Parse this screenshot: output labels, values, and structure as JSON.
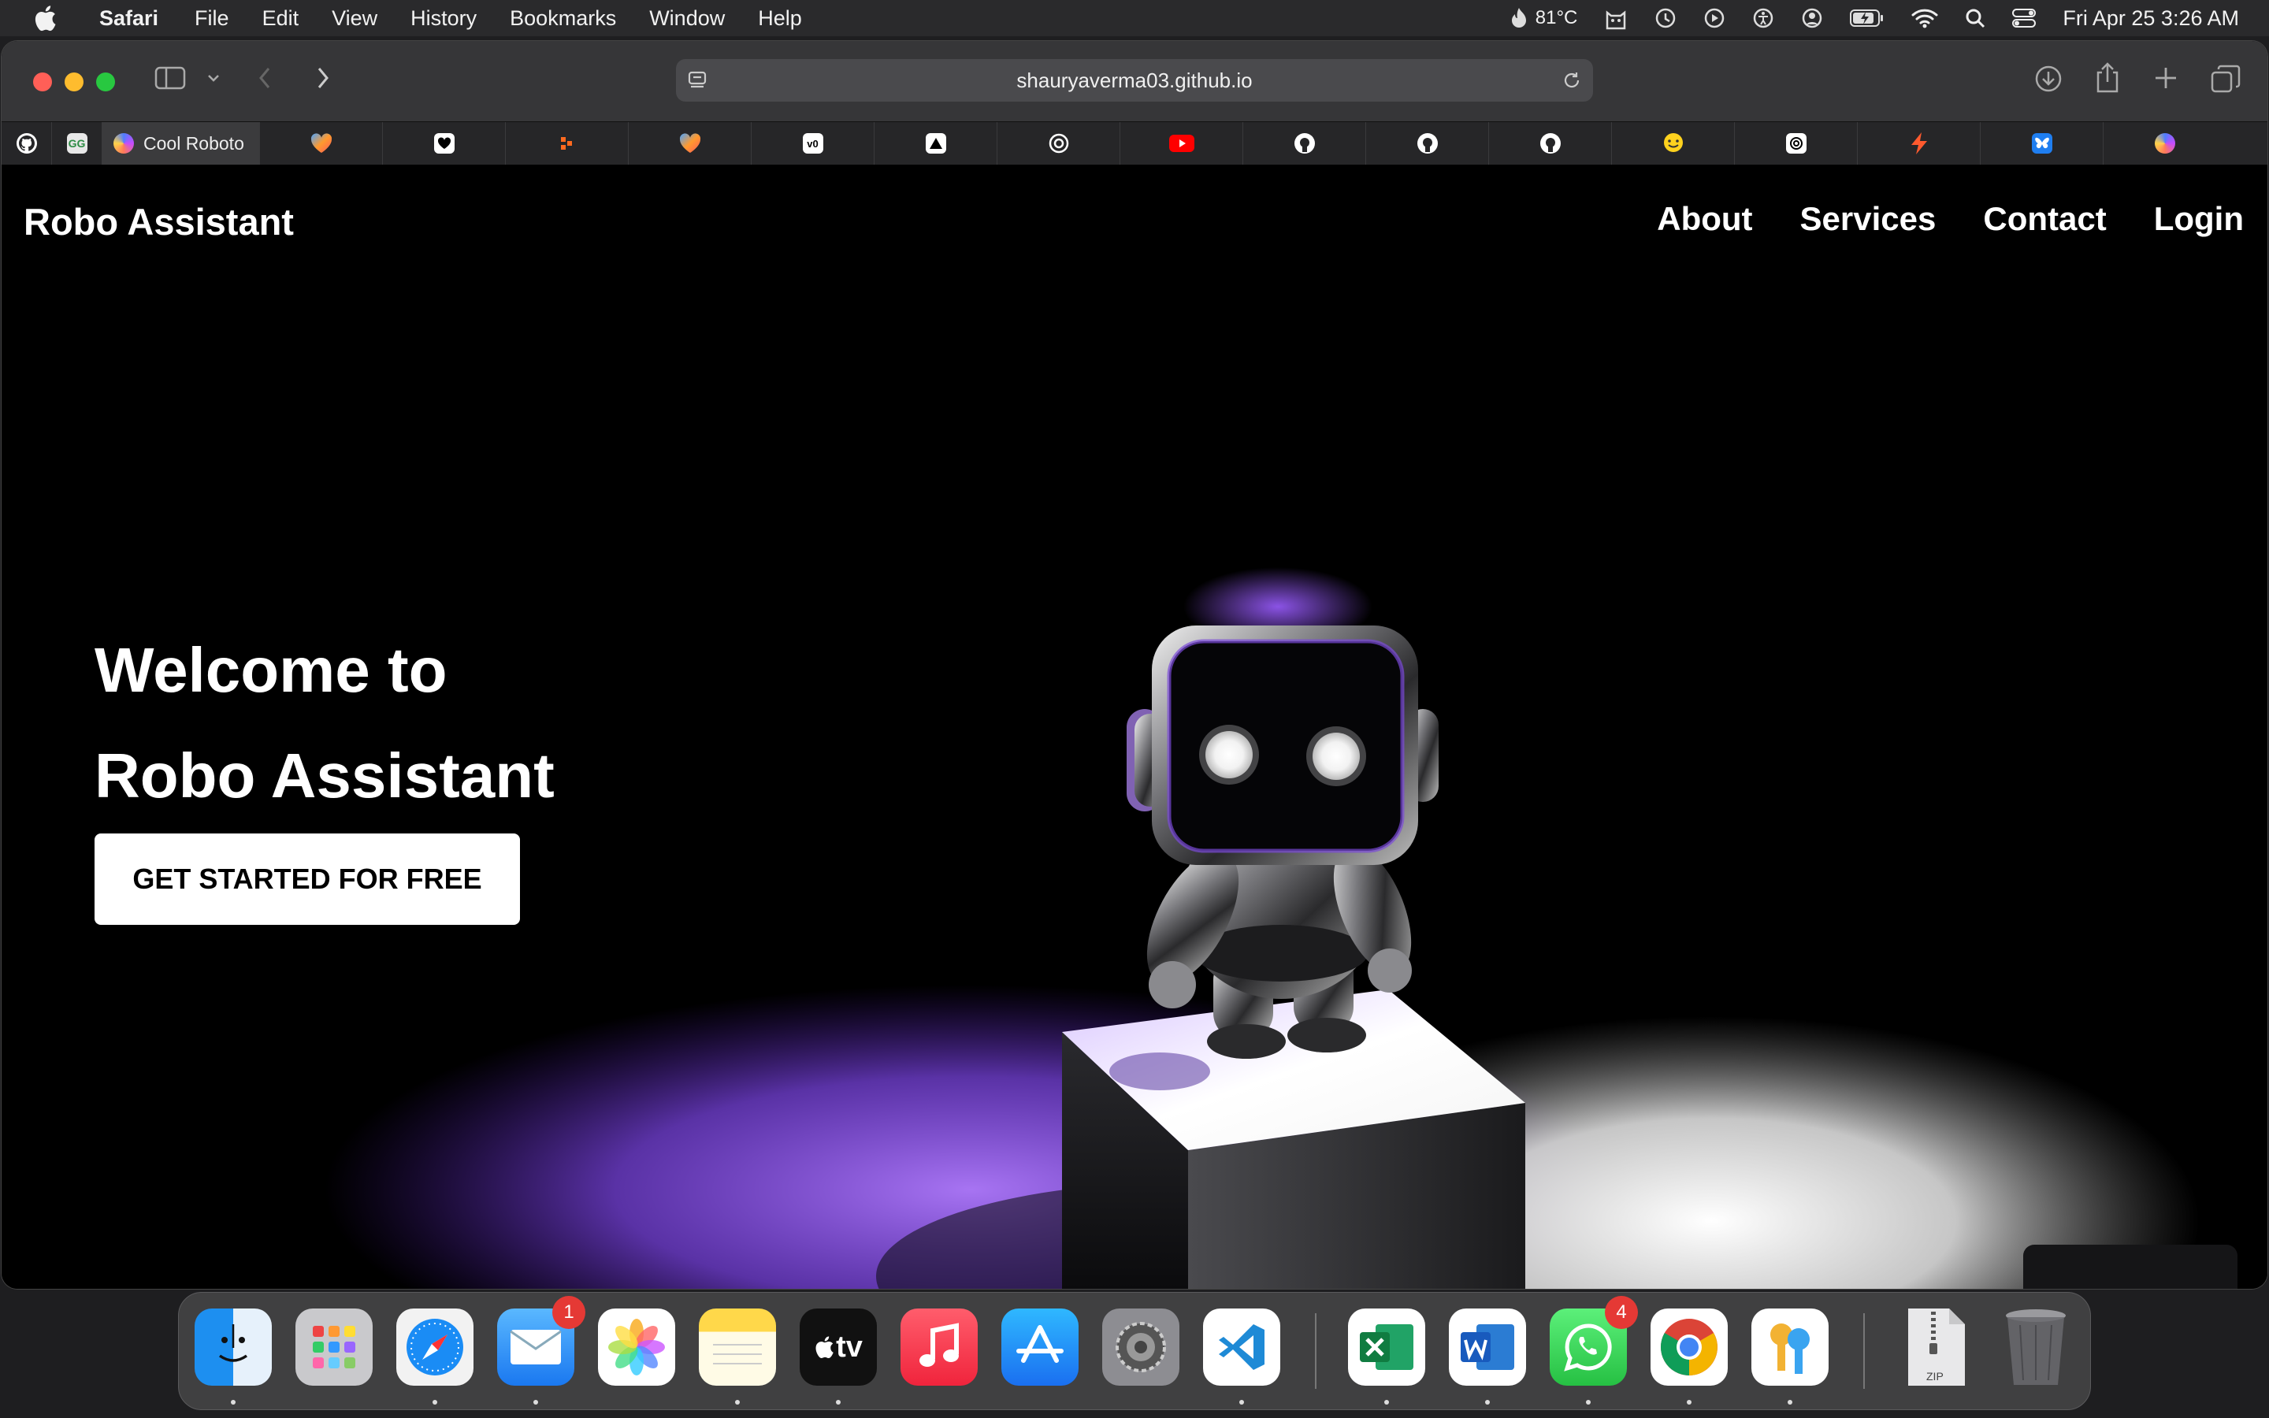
{
  "menubar": {
    "app_name": "Safari",
    "menus": [
      "File",
      "Edit",
      "View",
      "History",
      "Bookmarks",
      "Window",
      "Help"
    ],
    "temperature": "81°C",
    "datetime": "Fri Apr 25  3:26 AM"
  },
  "browser": {
    "url": "shauryaverma03.github.io",
    "active_tab_label": "Cool Roboto"
  },
  "page": {
    "brand": "Robo Assistant",
    "nav": [
      "About",
      "Services",
      "Contact",
      "Login"
    ],
    "hero_line1": "Welcome to",
    "hero_line2": "Robo Assistant",
    "cta_label": "GET STARTED FOR FREE"
  },
  "dock": {
    "mail_badge": "1",
    "whatsapp_badge": "4",
    "tv_label": "tv",
    "zip_label": "ZIP"
  },
  "colors": {
    "accent_purple": "#8a4dff",
    "page_background": "#000000",
    "cta_background": "#ffffff"
  }
}
